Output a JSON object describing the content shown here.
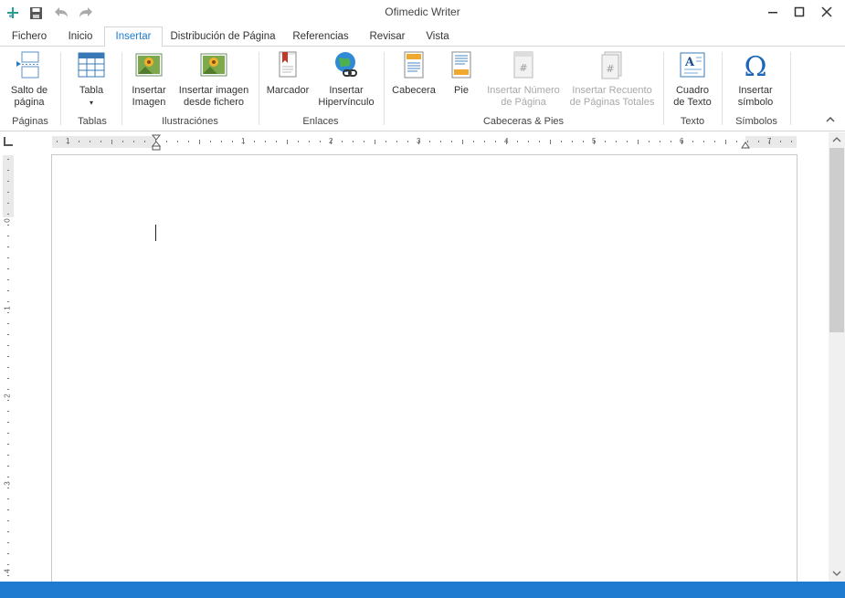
{
  "window": {
    "title": "Ofimedic Writer"
  },
  "icons": {
    "quick_add": "add-icon",
    "save": "save-icon",
    "undo": "undo-icon",
    "redo": "redo-icon",
    "minimize": "minimize-icon",
    "maximize": "maximize-icon",
    "close": "close-icon"
  },
  "tabs": [
    {
      "label": "Fichero"
    },
    {
      "label": "Inicio"
    },
    {
      "label": "Insertar",
      "active": true
    },
    {
      "label": "Distribución de Página"
    },
    {
      "label": "Referencias"
    },
    {
      "label": "Revisar"
    },
    {
      "label": "Vista"
    }
  ],
  "ribbon": {
    "buttons": {
      "salto": {
        "line1": "Salto de",
        "line2": "página"
      },
      "tabla": {
        "line1": "Tabla",
        "line2": "▾"
      },
      "imagen": {
        "line1": "Insertar",
        "line2": "Imagen"
      },
      "imagen_fichero": {
        "line1": "Insertar imagen",
        "line2": "desde fichero"
      },
      "marcador": {
        "line1": "Marcador",
        "line2": ""
      },
      "hipervinculo": {
        "line1": "Insertar",
        "line2": "Hipervínculo"
      },
      "cabecera": {
        "line1": "Cabecera",
        "line2": ""
      },
      "pie": {
        "line1": "Pie",
        "line2": ""
      },
      "num_pagina": {
        "line1": "Insertar Número",
        "line2": "de Página"
      },
      "recuento": {
        "line1": "Insertar Recuento",
        "line2": "de Páginas Totales"
      },
      "cuadro_texto": {
        "line1": "Cuadro",
        "line2": "de Texto"
      },
      "simbolo": {
        "line1": "Insertar",
        "line2": "símbolo"
      }
    },
    "groups": {
      "paginas": "Páginas",
      "tablas": "Tablas",
      "ilustraciones": "Ilustraciónes",
      "enlaces": "Enlaces",
      "cabeceras": "Cabeceras & Pies",
      "texto": "Texto",
      "simbolos": "Símbolos"
    }
  },
  "ruler": {
    "h_numbers": [
      "1",
      "1",
      "2",
      "3",
      "4",
      "5",
      "6",
      "7"
    ],
    "v_numbers": [
      "0",
      "1",
      "2",
      "3",
      "4"
    ]
  },
  "colors": {
    "accent": "#1e7bd0",
    "status_bar": "#1e7bd0"
  }
}
